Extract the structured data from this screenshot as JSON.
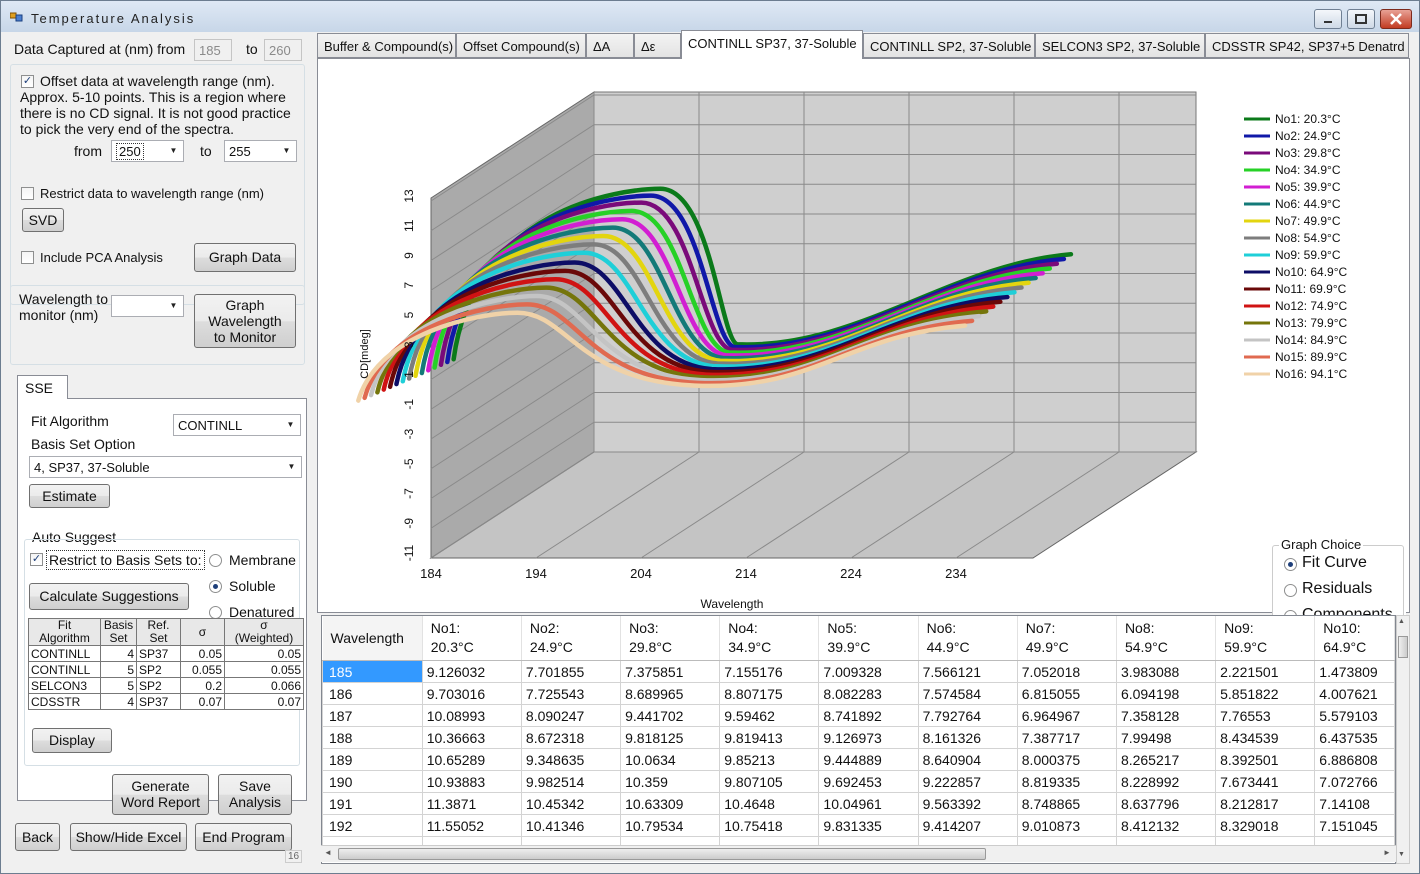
{
  "window": {
    "title": "Temperature Analysis"
  },
  "capture": {
    "label_from": "Data Captured at (nm) from",
    "from_value": "185",
    "label_to": "to",
    "to_value": "260"
  },
  "offset": {
    "checked": true,
    "text_lines": [
      "Offset data at wavelength range (nm).",
      "Approx. 5-10 points. This is a region where",
      "there is no CD signal. It is not good practice",
      "to pick the very end of the spectra."
    ],
    "from_label": "from",
    "from_value": "250",
    "to_label": "to",
    "to_value": "255"
  },
  "restrict_range": {
    "checked": false,
    "label": "Restrict data to wavelength range (nm)"
  },
  "svd_button": "SVD",
  "pca": {
    "checked": false,
    "label": "Include PCA Analysis"
  },
  "graph_data_button": "Graph Data",
  "monitor": {
    "label_lines": [
      "Wavelength to",
      "monitor (nm)"
    ],
    "value": "",
    "button_lines": [
      "Graph",
      "Wavelength",
      "to Monitor"
    ]
  },
  "sse": {
    "tab_label": "SSE",
    "fit_algorithm_label": "Fit Algorithm",
    "fit_algorithm_value": "CONTINLL",
    "basis_label": "Basis Set Option",
    "basis_value": "4, SP37, 37-Soluble",
    "estimate_button": "Estimate",
    "auto_suggest_label": "Auto Suggest",
    "restrict_checked": true,
    "restrict_label": "Restrict to Basis Sets to:",
    "radios": [
      {
        "label": "Membrane",
        "on": false
      },
      {
        "label": "Soluble",
        "on": true
      },
      {
        "label": "Denatured",
        "on": false
      }
    ],
    "calc_button": "Calculate Suggestions",
    "table_headers": [
      [
        "Fit",
        "Algorithm"
      ],
      [
        "Basis",
        "Set"
      ],
      [
        "Ref.",
        "Set"
      ],
      [
        "σ",
        ""
      ],
      [
        "σ",
        "(Weighted)"
      ]
    ],
    "table_rows": [
      [
        "CONTINLL",
        "4",
        "SP37",
        "0.05",
        "0.05"
      ],
      [
        "CONTINLL",
        "5",
        "SP2",
        "0.055",
        "0.055"
      ],
      [
        "SELCON3",
        "5",
        "SP2",
        "0.2",
        "0.066"
      ],
      [
        "CDSSTR",
        "4",
        "SP37",
        "0.07",
        "0.07"
      ]
    ],
    "display_button": "Display"
  },
  "bottom_buttons": {
    "report_lines": [
      "Generate",
      "Word Report"
    ],
    "save_lines": [
      "Save",
      "Analysis"
    ],
    "back": "Back",
    "excel": "Show/Hide Excel",
    "end": "End Program",
    "count": "16"
  },
  "tabs": [
    "Buffer & Compound(s)",
    "Offset Compound(s)",
    "ΔA",
    "Δε",
    "CONTINLL SP37, 37-Soluble",
    "CONTINLL SP2, 37-Soluble",
    "SELCON3 SP2, 37-Soluble",
    "CDSSTR SP42, SP37+5 Denatrd"
  ],
  "active_tab": 4,
  "graph_choice": {
    "title": "Graph Choice",
    "options": [
      {
        "label": "Fit Curve",
        "on": true
      },
      {
        "label": "Residuals",
        "on": false
      },
      {
        "label": "Components",
        "on": false
      }
    ]
  },
  "chart_data": {
    "type": "line",
    "title": "",
    "xlabel": "Wavelength",
    "ylabel": "CD[mdeg]",
    "x_ticks": [
      "184",
      "194",
      "204",
      "214",
      "224",
      "234"
    ],
    "y_ticks": [
      "13",
      "11",
      "9",
      "7",
      "5",
      "3",
      "1",
      "-1",
      "-3",
      "-5",
      "-7",
      "-9",
      "-11"
    ],
    "xlim": [
      184,
      260
    ],
    "ylim": [
      -11,
      14
    ],
    "legend_position": "right",
    "series": [
      {
        "name": "No1: 20.3°C",
        "color": "#0b7a1a",
        "values": [
          -1,
          12.4
        ]
      },
      {
        "name": "No2: 24.9°C",
        "color": "#1018a8",
        "values": [
          -1,
          12.0
        ]
      },
      {
        "name": "No3: 29.8°C",
        "color": "#7a0a7a",
        "values": [
          -1,
          11.6
        ]
      },
      {
        "name": "No4: 34.9°C",
        "color": "#26d126",
        "values": [
          -1,
          11.1
        ]
      },
      {
        "name": "No5: 39.9°C",
        "color": "#d21ed2",
        "values": [
          -1,
          10.6
        ]
      },
      {
        "name": "No6: 44.9°C",
        "color": "#137a78",
        "values": [
          -1,
          10.1
        ]
      },
      {
        "name": "No7: 49.9°C",
        "color": "#e3d50f",
        "values": [
          -1,
          9.6
        ]
      },
      {
        "name": "No8: 54.9°C",
        "color": "#7d7d7d",
        "values": [
          -1,
          9.1
        ]
      },
      {
        "name": "No9: 59.9°C",
        "color": "#1fcfd8",
        "values": [
          -1,
          8.6
        ]
      },
      {
        "name": "No10: 64.9°C",
        "color": "#0d0d66",
        "values": [
          -1,
          8.0
        ]
      },
      {
        "name": "No11: 69.9°C",
        "color": "#6a0808",
        "values": [
          -1,
          7.5
        ]
      },
      {
        "name": "No12: 74.9°C",
        "color": "#d01313",
        "values": [
          -1,
          7.0
        ]
      },
      {
        "name": "No13: 79.9°C",
        "color": "#75750b",
        "values": [
          -1,
          6.5
        ]
      },
      {
        "name": "No14: 84.9°C",
        "color": "#c4c4c4",
        "values": [
          -1,
          6.0
        ]
      },
      {
        "name": "No15: 89.9°C",
        "color": "#e06a50",
        "values": [
          -1,
          5.5
        ]
      },
      {
        "name": "No16: 94.1°C",
        "color": "#f0d2a8",
        "values": [
          -1,
          5.0
        ]
      }
    ]
  },
  "grid": {
    "headers": [
      [
        "Wavelength",
        ""
      ],
      [
        "No1:",
        "20.3°C"
      ],
      [
        "No2:",
        "24.9°C"
      ],
      [
        "No3:",
        "29.8°C"
      ],
      [
        "No4:",
        "34.9°C"
      ],
      [
        "No5:",
        "39.9°C"
      ],
      [
        "No6:",
        "44.9°C"
      ],
      [
        "No7:",
        "49.9°C"
      ],
      [
        "No8:",
        "54.9°C"
      ],
      [
        "No9:",
        "59.9°C"
      ],
      [
        "No10:",
        "64.9°C"
      ]
    ],
    "rows": [
      [
        "185",
        "9.126032",
        "7.701855",
        "7.375851",
        "7.155176",
        "7.009328",
        "7.566121",
        "7.052018",
        "3.983088",
        "2.221501",
        "1.473809"
      ],
      [
        "186",
        "9.703016",
        "7.725543",
        "8.689965",
        "8.807175",
        "8.082283",
        "7.574584",
        "6.815055",
        "6.094198",
        "5.851822",
        "4.007621"
      ],
      [
        "187",
        "10.08993",
        "8.090247",
        "9.441702",
        "9.59462",
        "8.741892",
        "7.792764",
        "6.964967",
        "7.358128",
        "7.76553",
        "5.579103"
      ],
      [
        "188",
        "10.36663",
        "8.672318",
        "9.818125",
        "9.819413",
        "9.126973",
        "8.161326",
        "7.387717",
        "7.99498",
        "8.434539",
        "6.437535"
      ],
      [
        "189",
        "10.65289",
        "9.348635",
        "10.0634",
        "9.85213",
        "9.444889",
        "8.640904",
        "8.000375",
        "8.265217",
        "8.392501",
        "6.886808"
      ],
      [
        "190",
        "10.93883",
        "9.982514",
        "10.359",
        "9.807105",
        "9.692453",
        "9.222857",
        "8.819335",
        "8.228992",
        "7.673441",
        "7.072766"
      ],
      [
        "191",
        "11.3871",
        "10.45342",
        "10.63309",
        "10.4648",
        "10.04961",
        "9.563392",
        "8.748865",
        "8.637796",
        "8.212817",
        "7.14108"
      ],
      [
        "192",
        "11.55052",
        "10.41346",
        "10.79534",
        "10.75418",
        "9.831335",
        "9.414207",
        "9.010873",
        "8.412132",
        "8.329018",
        "7.151045"
      ]
    ]
  }
}
